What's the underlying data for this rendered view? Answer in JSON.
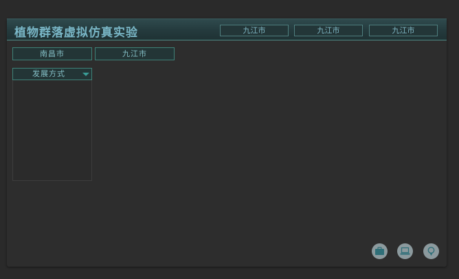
{
  "header": {
    "title": "植物群落虚拟仿真实验",
    "tabs": [
      {
        "label": "九江市"
      },
      {
        "label": "九江市"
      },
      {
        "label": "九江市"
      }
    ]
  },
  "location_chips": [
    {
      "label": "南昌市"
    },
    {
      "label": "九江市"
    }
  ],
  "dropdown": {
    "selected": "发展方式",
    "options": []
  },
  "toolbar": {
    "icons": [
      "briefcase-icon",
      "laptop-icon",
      "location-pin-icon"
    ]
  },
  "colors": {
    "accent": "#79b6c6",
    "border": "#3f8278",
    "icon_bg": "#8c9a9e",
    "icon_fg": "#2f6f78"
  }
}
